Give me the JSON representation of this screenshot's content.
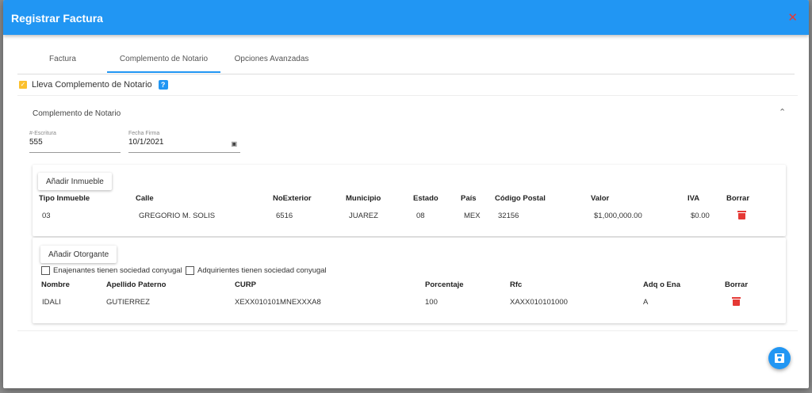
{
  "dialog": {
    "title": "Registrar Factura",
    "close_icon": "✕"
  },
  "tabs": [
    {
      "label": "Factura"
    },
    {
      "label": "Complemento de Notario"
    },
    {
      "label": "Opciones Avanzadas"
    }
  ],
  "lleva_complemento": {
    "label": "Lleva Complemento de Notario",
    "checked": true,
    "help": "?"
  },
  "section": {
    "title": "Complemento de Notario",
    "chevron": "^"
  },
  "escritura": {
    "label": "#-Escritura",
    "value": "555"
  },
  "fecha_firma": {
    "label": "Fecha Firma",
    "value": "10/1/2021"
  },
  "inmuebles": {
    "add_label": "Añadir Inmueble",
    "headers": [
      "Tipo Inmueble",
      "Calle",
      "NoExterior",
      "Municipio",
      "Estado",
      "País",
      "Código Postal",
      "Valor",
      "IVA",
      "Borrar"
    ],
    "rows": [
      [
        "03",
        "GREGORIO M. SOLIS",
        "6516",
        "JUAREZ",
        "08",
        "MEX",
        "32156",
        "$1,000,000.00",
        "$0.00"
      ]
    ]
  },
  "otorgantes": {
    "add_label": "Añadir Otorgante",
    "enajenantes_label": "Enajenantes tienen sociedad conyugal",
    "adquirientes_label": "Adquirientes tienen sociedad conyugal",
    "headers": [
      "Nombre",
      "Apellido Paterno",
      "CURP",
      "Porcentaje",
      "Rfc",
      "Adq o Ena",
      "Borrar"
    ],
    "rows": [
      [
        "IDALI",
        "GUTIERREZ",
        "XEXX010101MNEXXXA8",
        "100",
        "XAXX010101000",
        "A"
      ]
    ]
  },
  "colors": {
    "primary": "#2196f3",
    "danger": "#e53935",
    "checkbox": "#fbc02d"
  },
  "icons": {
    "save": "save-icon",
    "calendar": "calendar-icon",
    "trash": "trash-icon"
  }
}
